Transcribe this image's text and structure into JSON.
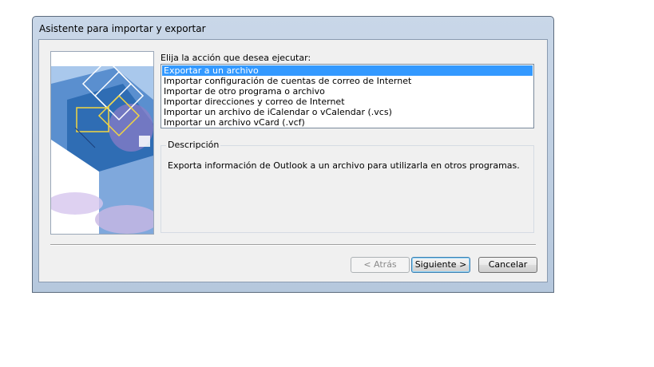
{
  "dialog": {
    "title": "Asistente para importar y exportar",
    "prompt": "Elija la acción que desea ejecutar:",
    "actions": [
      {
        "label": "Exportar a un archivo",
        "selected": true
      },
      {
        "label": "Importar configuración de cuentas de correo de Internet",
        "selected": false
      },
      {
        "label": "Importar de otro programa o archivo",
        "selected": false
      },
      {
        "label": "Importar direcciones y correo de Internet",
        "selected": false
      },
      {
        "label": "Importar un archivo de iCalendar o vCalendar (.vcs)",
        "selected": false
      },
      {
        "label": "Importar un archivo vCard (.vcf)",
        "selected": false
      }
    ],
    "description_label": "Descripción",
    "description_text": "Exporta información de Outlook a un archivo para utilizarla en otros programas.",
    "buttons": {
      "back": "< Atrás",
      "next": "Siguiente >",
      "cancel": "Cancelar"
    }
  },
  "colors": {
    "selection": "#3399ff",
    "frame": "#b6c8dd",
    "client": "#f0f0f0"
  }
}
